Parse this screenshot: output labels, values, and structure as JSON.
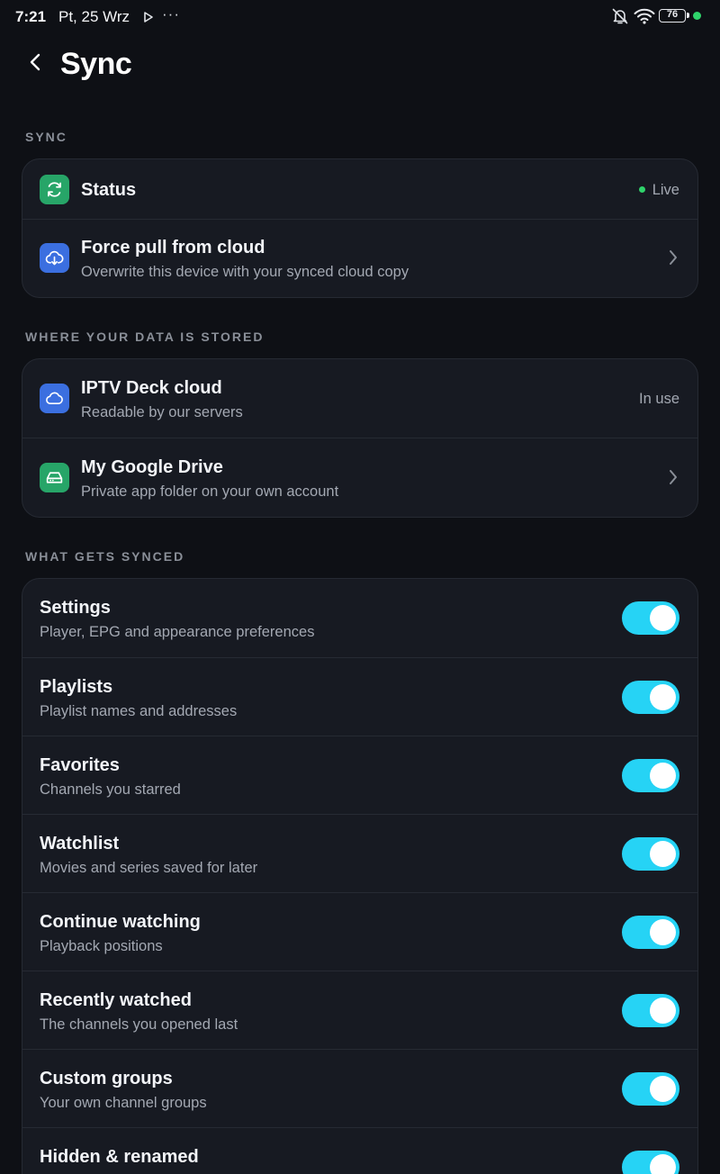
{
  "status_bar": {
    "time": "7:21",
    "date": "Pt, 25 Wrz",
    "more": "···",
    "battery": "76",
    "icons": [
      "play-arrow-icon",
      "bell-off-icon",
      "wifi-icon",
      "battery-icon"
    ]
  },
  "header": {
    "title": "Sync",
    "back_icon": "chevron-left-icon"
  },
  "sections": {
    "sync": {
      "label": "SYNC",
      "status": {
        "title": "Status",
        "value": "Live",
        "icon": "refresh-icon"
      },
      "force_pull": {
        "title": "Force pull from cloud",
        "subtitle": "Overwrite this device with your synced cloud copy",
        "icon": "cloud-download-icon"
      }
    },
    "storage": {
      "label": "WHERE YOUR DATA IS STORED",
      "iptv_cloud": {
        "title": "IPTV Deck cloud",
        "subtitle": "Readable by our servers",
        "value": "In use",
        "icon": "cloud-icon"
      },
      "google_drive": {
        "title": "My Google Drive",
        "subtitle": "Private app folder on your own account",
        "icon": "drive-icon"
      }
    },
    "synced": {
      "label": "WHAT GETS SYNCED",
      "items": [
        {
          "title": "Settings",
          "subtitle": "Player, EPG and appearance preferences",
          "enabled": true
        },
        {
          "title": "Playlists",
          "subtitle": "Playlist names and addresses",
          "enabled": true
        },
        {
          "title": "Favorites",
          "subtitle": "Channels you starred",
          "enabled": true
        },
        {
          "title": "Watchlist",
          "subtitle": "Movies and series saved for later",
          "enabled": true
        },
        {
          "title": "Continue watching",
          "subtitle": "Playback positions",
          "enabled": true
        },
        {
          "title": "Recently watched",
          "subtitle": "The channels you opened last",
          "enabled": true
        },
        {
          "title": "Custom groups",
          "subtitle": "Your own channel groups",
          "enabled": true
        },
        {
          "title": "Hidden & renamed",
          "subtitle": "",
          "enabled": true
        }
      ]
    }
  },
  "colors": {
    "background": "#0e1015",
    "card": "#171a22",
    "accent_toggle": "#26d3f5",
    "green_icon": "#27a568",
    "blue_icon": "#3b6fe0",
    "live_dot": "#2fd36b"
  }
}
